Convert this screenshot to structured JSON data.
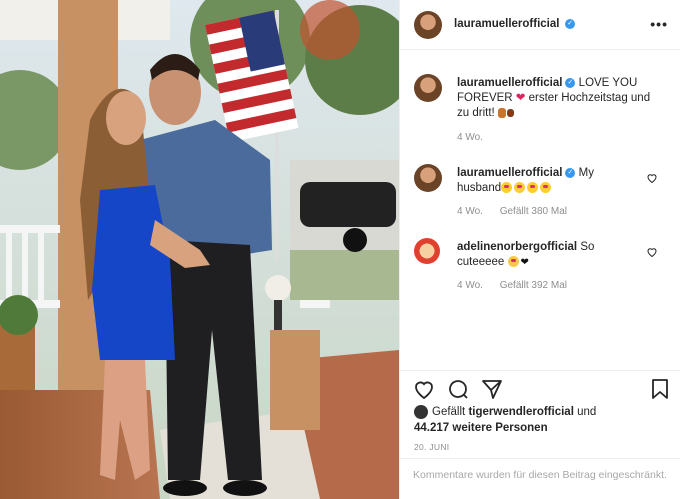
{
  "post": {
    "author": "lauramuellerofficial"
  },
  "comments": [
    {
      "user": "lauramuellerofficial",
      "text": "LOVE YOU FOREVER",
      "text2": "erster Hochzeitstag und zu dritt!",
      "time": "4 Wo."
    },
    {
      "user": "lauramuellerofficial",
      "text": "My husband",
      "time": "4 Wo.",
      "likes": "Gefällt 380 Mal"
    },
    {
      "user": "adelinenorbergofficial",
      "text": "So cuteeeee",
      "time": "4 Wo.",
      "likes": "Gefällt 392 Mal"
    }
  ],
  "likes": {
    "prefix": "Gefällt",
    "user": "tigerwendlerofficial",
    "mid": "und",
    "count": "44.217 weitere Personen"
  },
  "date": "20. JUNI",
  "restricted_text": "Kommentare wurden für diesen Beitrag eingeschränkt.",
  "icons": [
    "more-icon",
    "heart-icon",
    "comment-icon",
    "share-icon",
    "bookmark-icon",
    "verified-icon"
  ],
  "colors": {
    "verified": "#3897f0",
    "text": "#262626",
    "muted": "#8e8e8e"
  }
}
